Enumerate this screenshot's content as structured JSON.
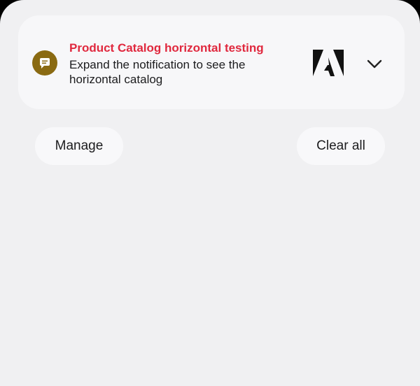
{
  "notification": {
    "title": "Product Catalog horizontal testing",
    "body": "Expand the notification to see the horizontal catalog",
    "app_icon": "chat-bubble-icon",
    "large_icon": "adobe-logo",
    "expand_icon": "chevron-down-icon",
    "title_color": "#e0283e",
    "app_icon_color": "#8a6a12"
  },
  "actions": {
    "manage_label": "Manage",
    "clear_all_label": "Clear all"
  }
}
